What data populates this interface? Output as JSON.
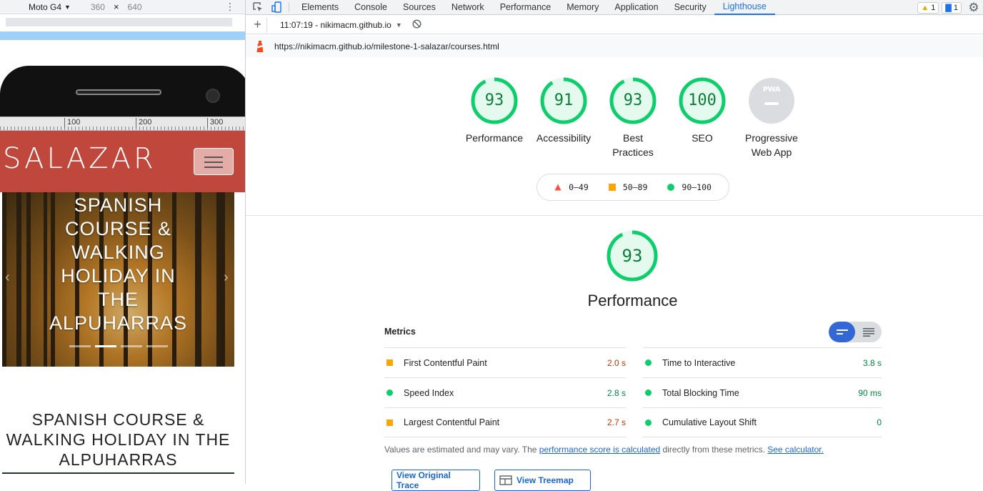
{
  "device_toolbar": {
    "device": "Moto G4",
    "width": "360",
    "times": "×",
    "height": "640"
  },
  "ruler": {
    "ticks": [
      "100",
      "200",
      "300"
    ]
  },
  "site": {
    "logo": "SALAZAR",
    "hero_title": "SPANISH COURSE & WALKING HOLIDAY IN THE ALPUHARRAS",
    "page_heading": "SPANISH COURSE & WALKING HOLIDAY IN THE ALPUHARRAS"
  },
  "devtools": {
    "tabs": [
      "Elements",
      "Console",
      "Sources",
      "Network",
      "Performance",
      "Memory",
      "Application",
      "Security",
      "Lighthouse"
    ],
    "selected_tab": "Lighthouse",
    "warnings_count": "1",
    "messages_count": "1",
    "report_select": "11:07:19 - nikimacm.github.io",
    "report_url": "https://nikimacm.github.io/milestone-1-salazar/courses.html"
  },
  "categories": [
    {
      "label_1": "Performance",
      "label_2": "",
      "score": "93",
      "fraction": 0.93
    },
    {
      "label_1": "Accessibility",
      "label_2": "",
      "score": "91",
      "fraction": 0.91
    },
    {
      "label_1": "Best",
      "label_2": "Practices",
      "score": "93",
      "fraction": 0.93
    },
    {
      "label_1": "SEO",
      "label_2": "",
      "score": "100",
      "fraction": 1.0
    },
    {
      "label_1": "Progressive",
      "label_2": "Web App",
      "score": "",
      "pwa_text": "PWA"
    }
  ],
  "legend": {
    "fail": "0–49",
    "average": "50–89",
    "pass": "90–100"
  },
  "performance": {
    "score": "93",
    "fraction": 0.93,
    "title": "Performance",
    "metrics_header": "Metrics",
    "metrics_left": [
      {
        "name": "First Contentful Paint",
        "value": "2.0 s",
        "rating": "average"
      },
      {
        "name": "Speed Index",
        "value": "2.8 s",
        "rating": "pass"
      },
      {
        "name": "Largest Contentful Paint",
        "value": "2.7 s",
        "rating": "average"
      }
    ],
    "metrics_right": [
      {
        "name": "Time to Interactive",
        "value": "3.8 s",
        "rating": "pass"
      },
      {
        "name": "Total Blocking Time",
        "value": "90 ms",
        "rating": "pass"
      },
      {
        "name": "Cumulative Layout Shift",
        "value": "0",
        "rating": "pass"
      }
    ],
    "note_prefix": "Values are estimated and may vary. The ",
    "note_link": "performance score is calculated",
    "note_mid": " directly from these metrics. ",
    "note_link2": "See calculator.",
    "btn_trace": "View Original Trace",
    "btn_treemap": "View Treemap"
  },
  "colors": {
    "pass": "#0cce6b",
    "average": "#ffa400",
    "fail": "#ff4e42",
    "header_red": "#c0473b",
    "accent_blue": "#1a73e8"
  }
}
